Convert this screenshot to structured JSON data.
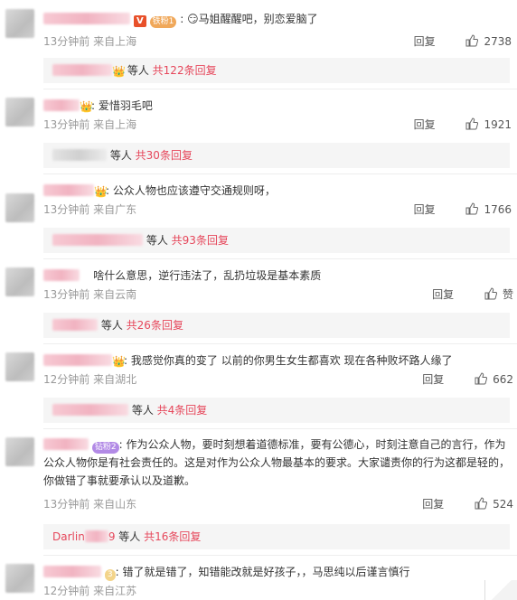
{
  "comments": [
    {
      "badge_v": "V",
      "fan_badge": "铁粉1",
      "text": "马姐醒醒吧，别恋爱脑了",
      "time": "13分钟前",
      "location": "来自上海",
      "reply_label": "回复",
      "likes": "2738",
      "replies": {
        "who": "等人",
        "count_text": "共122条回复"
      }
    },
    {
      "text": "爱惜羽毛吧",
      "time": "13分钟前",
      "location": "来自上海",
      "reply_label": "回复",
      "likes": "1921",
      "replies": {
        "who": "等人",
        "count_text": "共30条回复"
      }
    },
    {
      "text": "公众人物也应该遵守交通规则呀，",
      "time": "13分钟前",
      "location": "来自广东",
      "reply_label": "回复",
      "likes": "1766",
      "replies": {
        "who": "等人",
        "count_text": "共93条回复"
      }
    },
    {
      "text": "啥什么意思，逆行违法了，乱扔垃圾是基本素质",
      "time": "13分钟前",
      "location": "来自云南",
      "reply_label": "回复",
      "likes": "赞",
      "replies": {
        "who": "等人",
        "count_text": "共26条回复"
      }
    },
    {
      "text": "我感觉你真的变了 以前的你男生女生都喜欢 现在各种败坏路人缘了",
      "time": "12分钟前",
      "location": "来自湖北",
      "reply_label": "回复",
      "likes": "662",
      "replies": {
        "who": "等人",
        "count_text": "共4条回复"
      }
    },
    {
      "fan_badge": "钻粉2",
      "text": "作为公众人物，要时刻想着道德标准，要有公德心，时刻注意自己的言行，作为公众人物你是有社会责任的。这是对作为公众人物最基本的要求。大家谴责你的行为这都是轻的，你做错了事就要承认以及道歉。",
      "time": "13分钟前",
      "location": "来自山东",
      "reply_label": "回复",
      "likes": "524",
      "replies": {
        "name_prefix": "Darlin",
        "name_suffix": "9",
        "who": "等人",
        "count_text": "共16条回复"
      }
    },
    {
      "fan_badge": "3",
      "text": "错了就是错了，知错能改就是好孩子，，马思纯以后谨言慎行",
      "time": "12分钟前",
      "location": "来自江苏"
    }
  ],
  "colors": {
    "accent": "#e6475b",
    "meta": "#999999",
    "sub_bg": "#f5f5f5"
  },
  "icons": {
    "like": "thumb-up-icon",
    "crown": "crown-badge-icon"
  }
}
